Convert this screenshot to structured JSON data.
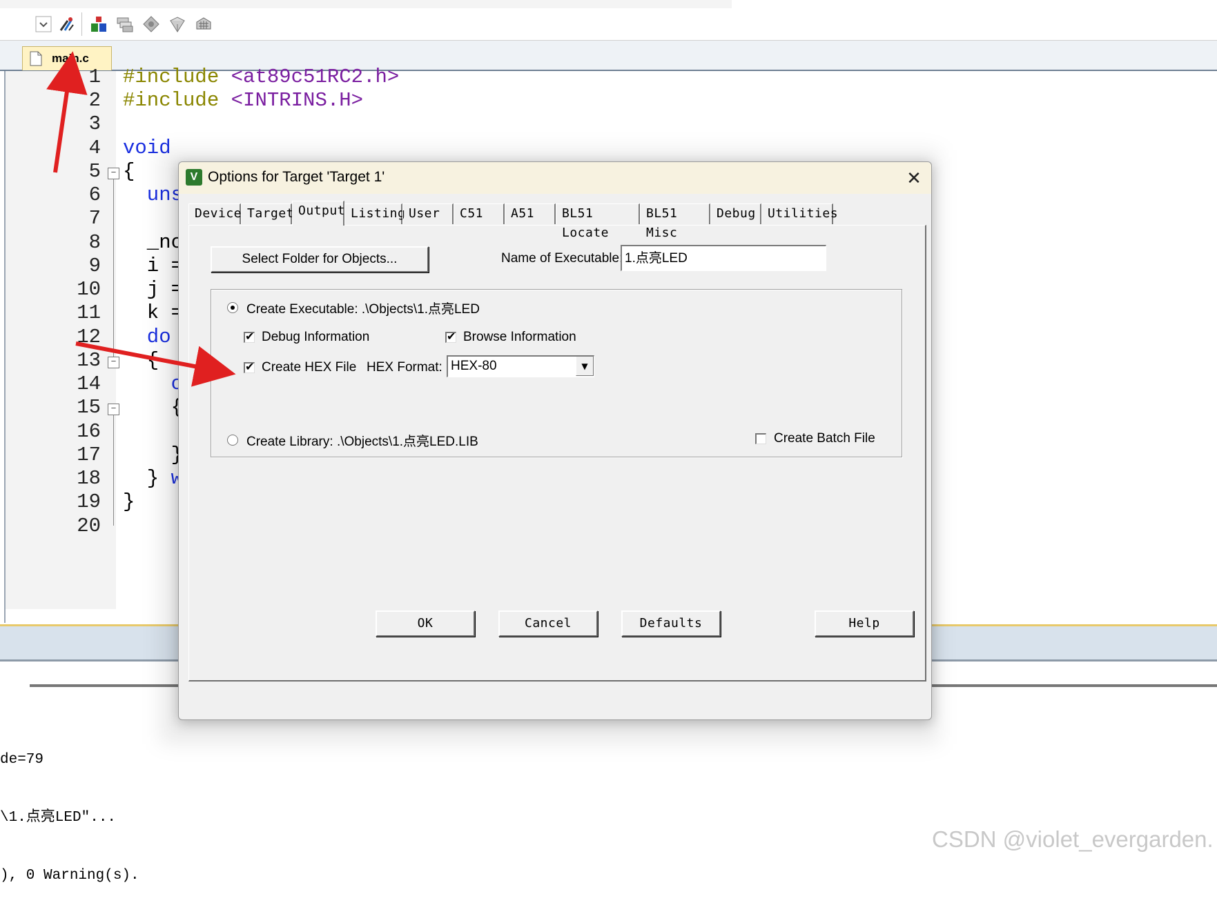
{
  "toolbar": {
    "buttons": [
      "options-for-target-icon",
      "manage-project-items-icon",
      "select-packs-icon",
      "manage-run-time-icon",
      "pack-installer-icon",
      "component-viewer-icon"
    ]
  },
  "editor": {
    "file_tab": "main.c",
    "line_numbers": [
      "1",
      "2",
      "3",
      "4",
      "5",
      "6",
      "7",
      "8",
      "9",
      "10",
      "11",
      "12",
      "13",
      "14",
      "15",
      "16",
      "17",
      "18",
      "19",
      "20"
    ],
    "lines": {
      "l1_a": "#include",
      "l1_b": "<at89c51RC2.h>",
      "l2_a": "#include",
      "l2_b": "<INTRINS.H>",
      "l4": "void",
      "l5": "{",
      "l6": "  uns",
      "l8": "  _nc",
      "l9": "  i =",
      "l10": "  j =",
      "l11": "  k =",
      "l12": "  do",
      "l13": "  {",
      "l14": "    c",
      "l15": "    {",
      "l17": "    }",
      "l18_a": "  }",
      "l18_b": "w",
      "l19": "}"
    }
  },
  "output": {
    "lines": [
      "de=79",
      "\\1.点亮LED\"...",
      "), 0 Warning(s)."
    ]
  },
  "dialog": {
    "title": "Options for Target 'Target 1'",
    "close_label": "✕",
    "tabs": [
      "Device",
      "Target",
      "Output",
      "Listing",
      "User",
      "C51",
      "A51",
      "BL51 Locate",
      "BL51 Misc",
      "Debug",
      "Utilities"
    ],
    "active_tab": "Output",
    "select_folder_label": "Select Folder for Objects...",
    "name_of_executable_label": "Name of Executable:",
    "name_of_executable_value": "1.点亮LED",
    "create_executable_label": "Create Executable:  .\\Objects\\1.点亮LED",
    "debug_info_label": "Debug Information",
    "browse_info_label": "Browse Information",
    "create_hex_label": "Create HEX File",
    "hex_format_label": "HEX Format:",
    "hex_format_value": "HEX-80",
    "create_library_label": "Create Library:  .\\Objects\\1.点亮LED.LIB",
    "create_batch_label": "Create Batch File",
    "ok_label": "OK",
    "cancel_label": "Cancel",
    "defaults_label": "Defaults",
    "help_label": "Help",
    "state": {
      "create_executable": true,
      "create_library": false,
      "debug_information": true,
      "browse_information": true,
      "create_hex_file": true,
      "create_batch_file": false
    }
  },
  "watermark": "CSDN @violet_evergarden.",
  "colors": {
    "annotation_arrow": "#e02020",
    "include_keyword": "#8a8600",
    "header_string": "#7a1ea0",
    "keyword_blue": "#1a2fe0"
  }
}
